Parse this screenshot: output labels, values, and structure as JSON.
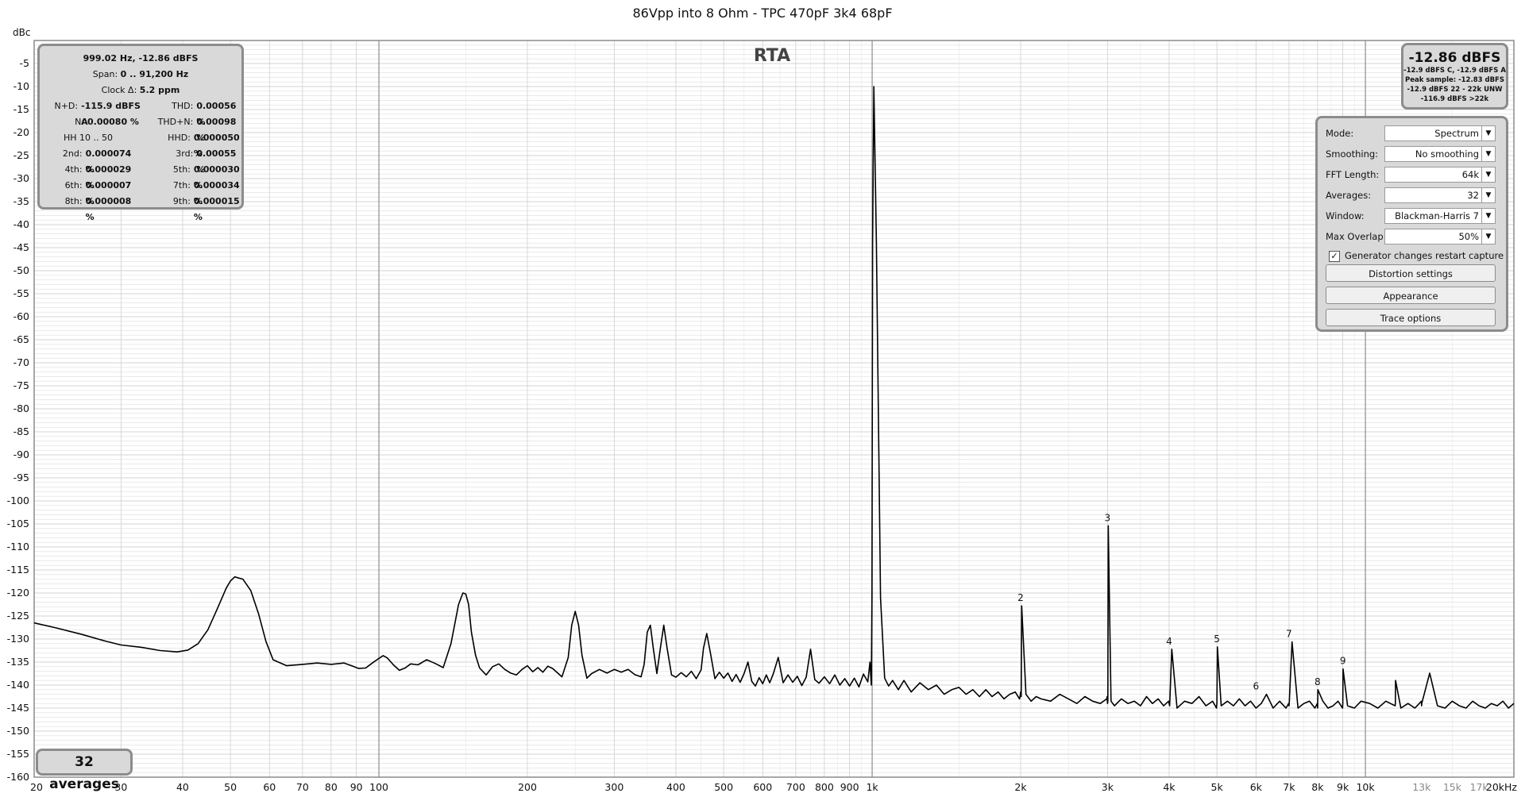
{
  "page_title": "86Vpp into 8 Ohm - TPC 470pF 3k4 68pF",
  "stats_panel": {
    "line1": "999.02 Hz, -12.86 dBFS",
    "span_label": "Span:",
    "span_value": "0 .. 91,200 Hz",
    "clock_label": "Clock Δ:",
    "clock_value": "5.2 ppm",
    "rows": [
      {
        "l_label": "N+D:",
        "l_value": "-115.9 dBFS A",
        "r_label": "THD:",
        "r_value": "0.00056 %"
      },
      {
        "l_label": "N:",
        "l_value": "0.00080 %",
        "r_label": "THD+N:",
        "r_value": "0.00098 %"
      },
      {
        "l_label": "",
        "l_value": "HH 10 .. 50",
        "r_label": "HHD:",
        "r_value": "0.000050 %"
      },
      {
        "l_label": "2nd:",
        "l_value": "0.000074 %",
        "r_label": "3rd:",
        "r_value": "0.00055 %"
      },
      {
        "l_label": "4th:",
        "l_value": "0.000029 %",
        "r_label": "5th:",
        "r_value": "0.000030 %"
      },
      {
        "l_label": "6th:",
        "l_value": "0.000007 %",
        "r_label": "7th:",
        "r_value": "0.000034 %"
      },
      {
        "l_label": "8th:",
        "l_value": "0.000008 %",
        "r_label": "9th:",
        "r_value": "0.000015 %"
      }
    ]
  },
  "level_panel": {
    "big": "-12.86 dBFS",
    "lines": [
      "-12.9 dBFS C, -12.9 dBFS A",
      "Peak sample: -12.83 dBFS",
      "-12.9 dBFS 22 - 22k UNW",
      "-116.9 dBFS >22k"
    ]
  },
  "controls": {
    "mode_label": "Mode:",
    "mode_value": "Spectrum",
    "smoothing_label": "Smoothing:",
    "smoothing_value": "No  smoothing",
    "fft_label": "FFT Length:",
    "fft_value": "64k",
    "averages_label": "Averages:",
    "averages_value": "32",
    "window_label": "Window:",
    "window_value": "Blackman-Harris 7",
    "overlap_label": "Max Overlap:",
    "overlap_value": "50%",
    "generator_label": "Generator changes restart capture",
    "generator_checked": true,
    "distortion_button": "Distortion settings",
    "appearance_button": "Appearance",
    "trace_button": "Trace options"
  },
  "averages_badge": "32 averages",
  "colors": {
    "trace": "#000000",
    "panel": "#d9d9d9",
    "panel_border": "#8c8c8c",
    "grid_major": "#9a9a9a",
    "grid_minor": "#dddddd"
  },
  "chart_data": {
    "type": "line",
    "title": "86Vpp into 8 Ohm - TPC 470pF 3k4 68pF",
    "annotation": "RTA",
    "xlabel": "",
    "ylabel": "dBc",
    "x_scale": "log",
    "xlim": [
      20,
      20000
    ],
    "ylim": [
      -160,
      0
    ],
    "grid": true,
    "x_ticks": [
      20,
      30,
      40,
      50,
      60,
      70,
      80,
      90,
      100,
      200,
      300,
      400,
      500,
      600,
      700,
      800,
      900,
      1000,
      2000,
      3000,
      4000,
      5000,
      6000,
      7000,
      8000,
      9000,
      10000,
      13000,
      15000,
      17000,
      20000
    ],
    "x_tick_labels": [
      "20",
      "30",
      "40",
      "50",
      "60",
      "70",
      "80",
      "90",
      "100",
      "200",
      "300",
      "400",
      "500",
      "600",
      "700",
      "800",
      "900",
      "1k",
      "2k",
      "3k",
      "4k",
      "5k",
      "6k",
      "7k",
      "8k",
      "9k",
      "10k",
      "13k",
      "15k",
      "17k",
      "20kHz"
    ],
    "y_ticks": [
      -5,
      -10,
      -15,
      -20,
      -25,
      -30,
      -35,
      -40,
      -45,
      -50,
      -55,
      -60,
      -65,
      -70,
      -75,
      -80,
      -85,
      -90,
      -95,
      -100,
      -105,
      -110,
      -115,
      -120,
      -125,
      -130,
      -135,
      -140,
      -145,
      -150,
      -155,
      -160
    ],
    "series": [
      {
        "x": [
          20,
          22,
          25,
          28,
          30,
          33,
          36,
          39,
          41,
          43,
          45,
          47,
          49,
          50,
          51,
          53,
          55,
          57,
          59,
          61,
          65,
          70,
          75,
          80,
          85,
          88,
          91,
          94,
          97,
          100,
          102,
          104,
          107,
          110,
          113,
          116,
          120,
          125,
          130,
          135,
          140,
          145,
          148,
          150,
          152,
          154,
          157,
          160,
          165,
          170,
          175,
          180,
          185,
          190,
          195,
          200,
          205,
          210,
          215,
          220,
          225,
          235,
          242,
          246,
          250,
          254,
          258,
          264,
          270,
          280,
          290,
          300,
          310,
          320,
          330,
          340,
          345,
          350,
          355,
          360,
          366,
          372,
          378,
          384,
          392,
          400,
          410,
          420,
          430,
          440,
          450,
          455,
          462,
          470,
          480,
          490,
          500,
          510,
          520,
          530,
          540,
          550,
          560,
          570,
          580,
          590,
          600,
          610,
          620,
          630,
          645,
          660,
          675,
          690,
          705,
          720,
          735,
          750,
          765,
          780,
          800,
          820,
          840,
          860,
          880,
          900,
          920,
          940,
          960,
          980,
          990,
          996,
          999,
          1002,
          1008,
          1020,
          1040,
          1060,
          1080,
          1100,
          1130,
          1160,
          1200,
          1250,
          1300,
          1350,
          1400,
          1450,
          1500,
          1550,
          1600,
          1650,
          1700,
          1750,
          1800,
          1850,
          1900,
          1950,
          1990,
          1995,
          2000,
          2005,
          2010,
          2050,
          2100,
          2150,
          2200,
          2300,
          2400,
          2500,
          2600,
          2700,
          2800,
          2900,
          2990,
          2995,
          3000,
          3005,
          3010,
          3050,
          3100,
          3200,
          3300,
          3400,
          3500,
          3600,
          3700,
          3800,
          3900,
          3990,
          4000,
          4010,
          4050,
          4150,
          4300,
          4450,
          4600,
          4750,
          4900,
          4990,
          5000,
          5010,
          5100,
          5250,
          5400,
          5550,
          5700,
          5850,
          6000,
          6150,
          6300,
          6500,
          6700,
          6900,
          6990,
          7000,
          7010,
          7100,
          7300,
          7500,
          7700,
          7900,
          7990,
          8000,
          8010,
          8200,
          8400,
          8600,
          8800,
          8990,
          9000,
          9010,
          9200,
          9500,
          9800,
          10200,
          10600,
          11000,
          11490,
          11500,
          11510,
          11800,
          12200,
          12600,
          12990,
          13000,
          13010,
          13500,
          14000,
          14500,
          15000,
          15500,
          16000,
          16500,
          17000,
          17500,
          18000,
          18500,
          19000,
          19500,
          20000
        ],
        "y": [
          -126.5,
          -127.5,
          -129,
          -130.5,
          -131.3,
          -131.8,
          -132.5,
          -132.8,
          -132.4,
          -131,
          -128,
          -123.5,
          -119,
          -117.4,
          -116.5,
          -117,
          -119.5,
          -124.5,
          -130.5,
          -134.5,
          -135.8,
          -135.5,
          -135.2,
          -135.5,
          -135.2,
          -135.8,
          -136.4,
          -136.3,
          -135.2,
          -134.2,
          -133.6,
          -134.1,
          -135.6,
          -136.8,
          -136.3,
          -135.4,
          -135.6,
          -134.5,
          -135.3,
          -136.2,
          -131,
          -122.5,
          -120,
          -120.2,
          -122.5,
          -128.5,
          -133.5,
          -136.3,
          -137.8,
          -136,
          -135.4,
          -136.6,
          -137.4,
          -137.8,
          -136.6,
          -135.8,
          -137.1,
          -136.2,
          -137.2,
          -135.9,
          -136.4,
          -138.2,
          -134,
          -127,
          -124,
          -127,
          -133.5,
          -138.5,
          -137.5,
          -136.6,
          -137.4,
          -136.6,
          -137.2,
          -136.6,
          -137.7,
          -138.2,
          -135.5,
          -128.5,
          -127,
          -132,
          -137.5,
          -132,
          -127,
          -132,
          -137.8,
          -138.3,
          -137.3,
          -138.2,
          -137,
          -138.6,
          -136.7,
          -132,
          -128.8,
          -133,
          -138.6,
          -137.2,
          -138.5,
          -137.4,
          -139.2,
          -137.7,
          -139.4,
          -137.5,
          -135,
          -139.2,
          -140.2,
          -138.4,
          -139.7,
          -137.8,
          -139.5,
          -137.6,
          -134,
          -139.5,
          -137.8,
          -139.4,
          -138.1,
          -140.1,
          -138.3,
          -132.2,
          -138.8,
          -139.6,
          -138.2,
          -139.7,
          -137.8,
          -140,
          -138.6,
          -140.2,
          -138.5,
          -140.4,
          -137.6,
          -139.3,
          -135,
          -140,
          -121,
          -44,
          -10,
          -44,
          -121,
          -138.5,
          -140.2,
          -139,
          -141,
          -139,
          -141.5,
          -139.5,
          -141,
          -140,
          -142,
          -141,
          -140.5,
          -142,
          -141,
          -142.5,
          -141,
          -142.5,
          -141.5,
          -143,
          -142,
          -141.5,
          -143,
          -142.5,
          -141.5,
          -142.5,
          -122.8,
          -142,
          -143.5,
          -142.5,
          -143,
          -143.5,
          -142,
          -143,
          -144,
          -142.5,
          -143.5,
          -144,
          -143,
          -142.5,
          -144,
          -143.5,
          -105.4,
          -143.5,
          -144.5,
          -143,
          -144,
          -143.5,
          -144.5,
          -142.5,
          -144,
          -143,
          -144.5,
          -143.5,
          -144,
          -144.5,
          -132.2,
          -145,
          -143.5,
          -144,
          -142.5,
          -144.5,
          -143.5,
          -145,
          -144,
          -131.7,
          -144.5,
          -143.5,
          -144.5,
          -143,
          -144.5,
          -143.5,
          -145,
          -144,
          -142,
          -145,
          -143.5,
          -145,
          -144,
          -144.5,
          -143.5,
          -130.6,
          -145,
          -144,
          -143.5,
          -145,
          -144,
          -145,
          -141,
          -143.5,
          -145,
          -144.5,
          -143.5,
          -145,
          -144,
          -136.5,
          -144.5,
          -145,
          -143.5,
          -144,
          -145,
          -143.5,
          -144.5,
          -144,
          -139,
          -145,
          -144,
          -145,
          -143.5,
          -144.5,
          -144,
          -137.4,
          -144.5,
          -145,
          -143.5,
          -144.5,
          -145,
          -143.5,
          -144.5,
          -145,
          -144,
          -144.5,
          -143.5,
          -145,
          -144
        ]
      }
    ],
    "harmonic_markers": [
      {
        "label": "2",
        "freq": 2000,
        "level": -122.8
      },
      {
        "label": "3",
        "freq": 3000,
        "level": -105.4
      },
      {
        "label": "4",
        "freq": 4000,
        "level": -132.2
      },
      {
        "label": "5",
        "freq": 5000,
        "level": -131.7
      },
      {
        "label": "6",
        "freq": 6000,
        "level": -142
      },
      {
        "label": "7",
        "freq": 7000,
        "level": -130.6
      },
      {
        "label": "8",
        "freq": 8000,
        "level": -141
      },
      {
        "label": "9",
        "freq": 9000,
        "level": -136.5
      }
    ]
  }
}
